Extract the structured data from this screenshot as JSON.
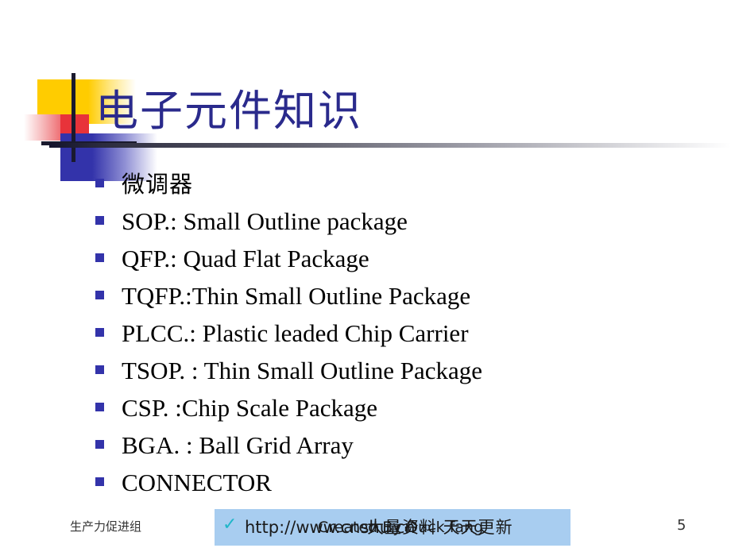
{
  "slide": {
    "title": "电子元件知识",
    "page_number": "5",
    "bullets": [
      {
        "text": "微调器",
        "script": "cjk"
      },
      {
        "text": "SOP.: Small Outline package",
        "script": "latin"
      },
      {
        "text": "QFP.: Quad Flat Package",
        "script": "latin"
      },
      {
        "text": "TQFP.:Thin Small Outline Package",
        "script": "latin"
      },
      {
        "text": "PLCC.: Plastic leaded Chip Carrier",
        "script": "latin"
      },
      {
        "text": "TSOP. : Thin Small Outline Package",
        "script": "latin"
      },
      {
        "text": "CSP. :Chip Scale Package",
        "script": "latin"
      },
      {
        "text": "BGA. : Ball Grid Array",
        "script": "latin"
      },
      {
        "text": "CONNECTOR",
        "script": "latin"
      }
    ]
  },
  "footer": {
    "organization": "生产力促进组",
    "check_glyph": "✓",
    "url": "http://www.cnshu.cn",
    "credit": "Created By Duck fang",
    "tagline": "大量资料 天天更新"
  },
  "colors": {
    "title_blue": "#2a2a8c",
    "bullet_blue": "#3333aa",
    "deco_yellow": "#ffcc00",
    "deco_red": "#e8333a",
    "deco_blue": "#3333aa",
    "deco_dark": "#1a1a2e",
    "footer_box": "#a8cdf0",
    "check_teal": "#1fb6c8"
  }
}
